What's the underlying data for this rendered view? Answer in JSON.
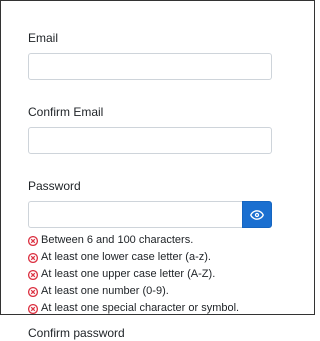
{
  "form": {
    "email_label": "Email",
    "email_value": "",
    "confirm_email_label": "Confirm Email",
    "confirm_email_value": "",
    "password_label": "Password",
    "password_value": "",
    "password_toggle_icon": "eye-icon",
    "requirements_icon": "x-circle-icon",
    "requirements_color": "#dc3545",
    "requirements": [
      "Between 6 and 100 characters.",
      "At least one lower case letter (a-z).",
      "At least one upper case letter (A-Z).",
      "At least one number (0-9).",
      "At least one special character or symbol."
    ],
    "confirm_password_label": "Confirm password"
  },
  "colors": {
    "accent": "#1a6fd0",
    "error": "#dc3545",
    "border": "#ced4da"
  }
}
